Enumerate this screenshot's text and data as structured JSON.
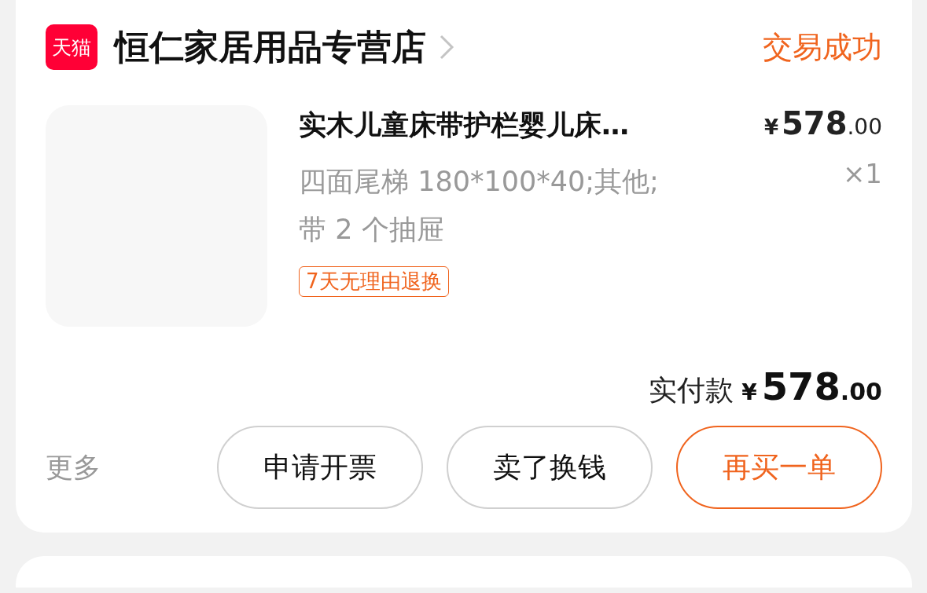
{
  "order": {
    "store": {
      "badge": "天猫",
      "name": "恒仁家居用品专营店"
    },
    "status": "交易成功",
    "item": {
      "title": "实木儿童床带护栏婴儿床…",
      "price": {
        "currency": "¥",
        "integer": "578",
        "decimal": ".00"
      },
      "spec": "四面尾梯 180*100*40;其他;\n带 2 个抽屉",
      "quantity": "×1",
      "tags": [
        "7天无理由退换"
      ]
    },
    "total": {
      "label": "实付款",
      "currency": "¥",
      "integer": "578",
      "decimal": ".00"
    },
    "more": "更多",
    "buttons": [
      {
        "label": "申请开票",
        "kind": "plain"
      },
      {
        "label": "卖了换钱",
        "kind": "plain"
      },
      {
        "label": "再买一单",
        "kind": "primary"
      }
    ]
  }
}
